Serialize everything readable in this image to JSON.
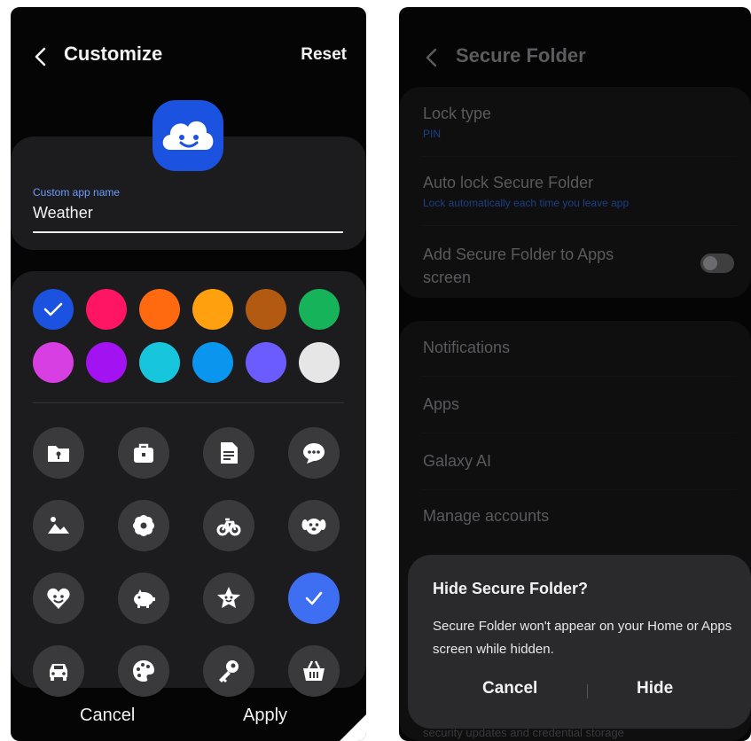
{
  "customize": {
    "title": "Customize",
    "reset_label": "Reset",
    "app_name_label": "Custom app name",
    "app_name_value": "Weather",
    "cancel_label": "Cancel",
    "apply_label": "Apply",
    "colors": [
      "#1c52e0",
      "#ff1563",
      "#ff6a10",
      "#ffa00e",
      "#b25a12",
      "#17b35b",
      "#d83fe2",
      "#a313f1",
      "#17c6dc",
      "#0a96ef",
      "#6b5cff",
      "#e6e6e6"
    ],
    "selected_color": "#1c52e0",
    "icons": [
      "folder-lock-icon",
      "briefcase-icon",
      "document-icon",
      "chat-bubble-icon",
      "picture-icon",
      "flower-icon",
      "bicycle-icon",
      "dog-icon",
      "heart-smile-icon",
      "piggy-bank-icon",
      "star-smile-icon",
      "check-selected-icon",
      "car-icon",
      "palette-icon",
      "key-icon",
      "basket-icon"
    ]
  },
  "secure_folder": {
    "title": "Secure Folder",
    "lock_type_label": "Lock type",
    "lock_type_value": "PIN",
    "auto_lock_label": "Auto lock Secure Folder",
    "auto_lock_value": "Lock automatically each time you leave app",
    "add_to_apps_label": "Add Secure Folder to Apps screen",
    "add_to_apps_enabled": false,
    "notifications_label": "Notifications",
    "apps_label": "Apps",
    "galaxy_ai_label": "Galaxy AI",
    "manage_accounts_label": "Manage accounts",
    "behind_text": "security updates and credential storage"
  },
  "dialog": {
    "title": "Hide Secure Folder?",
    "message": "Secure Folder won't appear on your Home or Apps screen while hidden.",
    "cancel_label": "Cancel",
    "hide_label": "Hide"
  }
}
